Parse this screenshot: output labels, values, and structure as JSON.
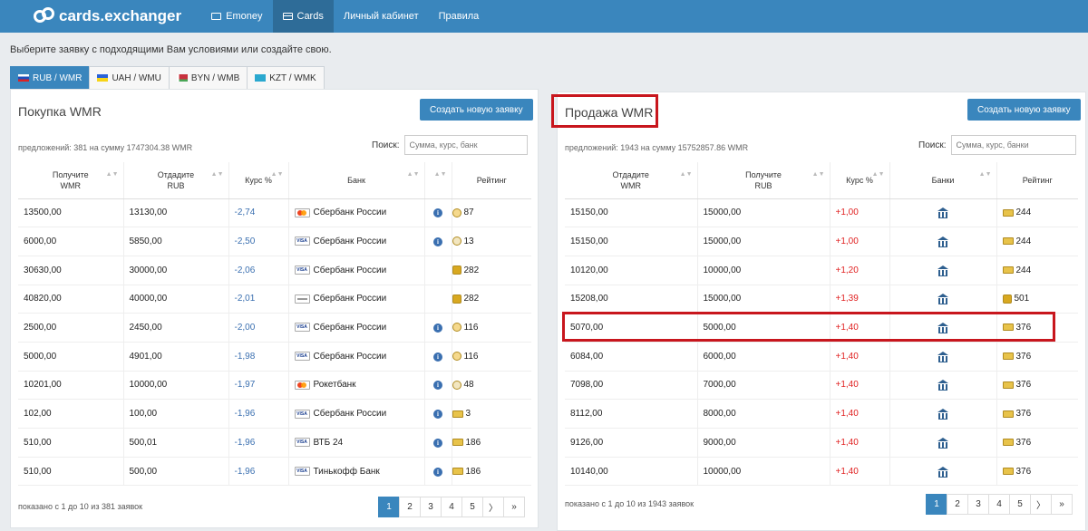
{
  "header": {
    "logo": "cards.exchanger",
    "nav": [
      {
        "label": "Emoney",
        "icon": "wallet-icon"
      },
      {
        "label": "Cards",
        "icon": "card-icon"
      },
      {
        "label": "Личный кабинет"
      },
      {
        "label": "Правила"
      }
    ]
  },
  "intro": "Выберите заявку с подходящими Вам условиями или создайте свою.",
  "tabs": [
    "RUB / WMR",
    "UAH / WMU",
    "BYN / WMB",
    "KZT / WMK"
  ],
  "buy": {
    "title": "Покупка WMR",
    "create_label": "Создать новую заявку",
    "offers": "предложений: 381 на сумму 1747304.38 WMR",
    "search_label": "Поиск:",
    "search_placeholder": "Сумма, курс, банк",
    "columns": [
      "Получите WMR",
      "Отдадите RUB",
      "Курс %",
      "Банк",
      "",
      "Рейтинг"
    ],
    "rows": [
      {
        "get": "13500,00",
        "give": "13130,00",
        "rate": "-2,74",
        "bank": "Сбербанк России",
        "rating": "87"
      },
      {
        "get": "6000,00",
        "give": "5850,00",
        "rate": "-2,50",
        "bank": "Сбербанк России",
        "rating": "13"
      },
      {
        "get": "30630,00",
        "give": "30000,00",
        "rate": "-2,06",
        "bank": "Сбербанк России",
        "rating": "282"
      },
      {
        "get": "40820,00",
        "give": "40000,00",
        "rate": "-2,01",
        "bank": "Сбербанк России",
        "rating": "282"
      },
      {
        "get": "2500,00",
        "give": "2450,00",
        "rate": "-2,00",
        "bank": "Сбербанк России",
        "rating": "116"
      },
      {
        "get": "5000,00",
        "give": "4901,00",
        "rate": "-1,98",
        "bank": "Сбербанк России",
        "rating": "116"
      },
      {
        "get": "10201,00",
        "give": "10000,00",
        "rate": "-1,97",
        "bank": "Рокетбанк",
        "rating": "48"
      },
      {
        "get": "102,00",
        "give": "100,00",
        "rate": "-1,96",
        "bank": "Сбербанк России",
        "rating": "3"
      },
      {
        "get": "510,00",
        "give": "500,01",
        "rate": "-1,96",
        "bank": "ВТБ 24",
        "rating": "186"
      },
      {
        "get": "510,00",
        "give": "500,00",
        "rate": "-1,96",
        "bank": "Тинькофф Банк",
        "rating": "186"
      }
    ],
    "footer": "показано с 1 до 10 из 381 заявок",
    "pages": [
      "1",
      "2",
      "3",
      "4",
      "5",
      "〉",
      "»"
    ]
  },
  "sell": {
    "title": "Продажа WMR",
    "create_label": "Создать новую заявку",
    "offers": "предложений: 1943 на сумму 15752857.86 WMR",
    "search_label": "Поиск:",
    "search_placeholder": "Сумма, курс, банки",
    "columns": [
      "Отдадите WMR",
      "Получите RUB",
      "Курс %",
      "Банки",
      "Рейтинг"
    ],
    "rows": [
      {
        "give": "15150,00",
        "get": "15000,00",
        "rate": "+1,00",
        "rating": "244"
      },
      {
        "give": "15150,00",
        "get": "15000,00",
        "rate": "+1,00",
        "rating": "244"
      },
      {
        "give": "10120,00",
        "get": "10000,00",
        "rate": "+1,20",
        "rating": "244"
      },
      {
        "give": "15208,00",
        "get": "15000,00",
        "rate": "+1,39",
        "rating": "501"
      },
      {
        "give": "5070,00",
        "get": "5000,00",
        "rate": "+1,40",
        "rating": "376"
      },
      {
        "give": "6084,00",
        "get": "6000,00",
        "rate": "+1,40",
        "rating": "376"
      },
      {
        "give": "7098,00",
        "get": "7000,00",
        "rate": "+1,40",
        "rating": "376"
      },
      {
        "give": "8112,00",
        "get": "8000,00",
        "rate": "+1,40",
        "rating": "376"
      },
      {
        "give": "9126,00",
        "get": "9000,00",
        "rate": "+1,40",
        "rating": "376"
      },
      {
        "give": "10140,00",
        "get": "10000,00",
        "rate": "+1,40",
        "rating": "376"
      }
    ],
    "footer": "показано с 1 до 10 из 1943 заявок",
    "pages": [
      "1",
      "2",
      "3",
      "4",
      "5",
      "〉",
      "»"
    ]
  },
  "colors": {
    "accent": "#3a86bd",
    "negative_rate": "#3a6fb0",
    "positive_rate": "#e02020",
    "highlight": "#c8161d"
  }
}
